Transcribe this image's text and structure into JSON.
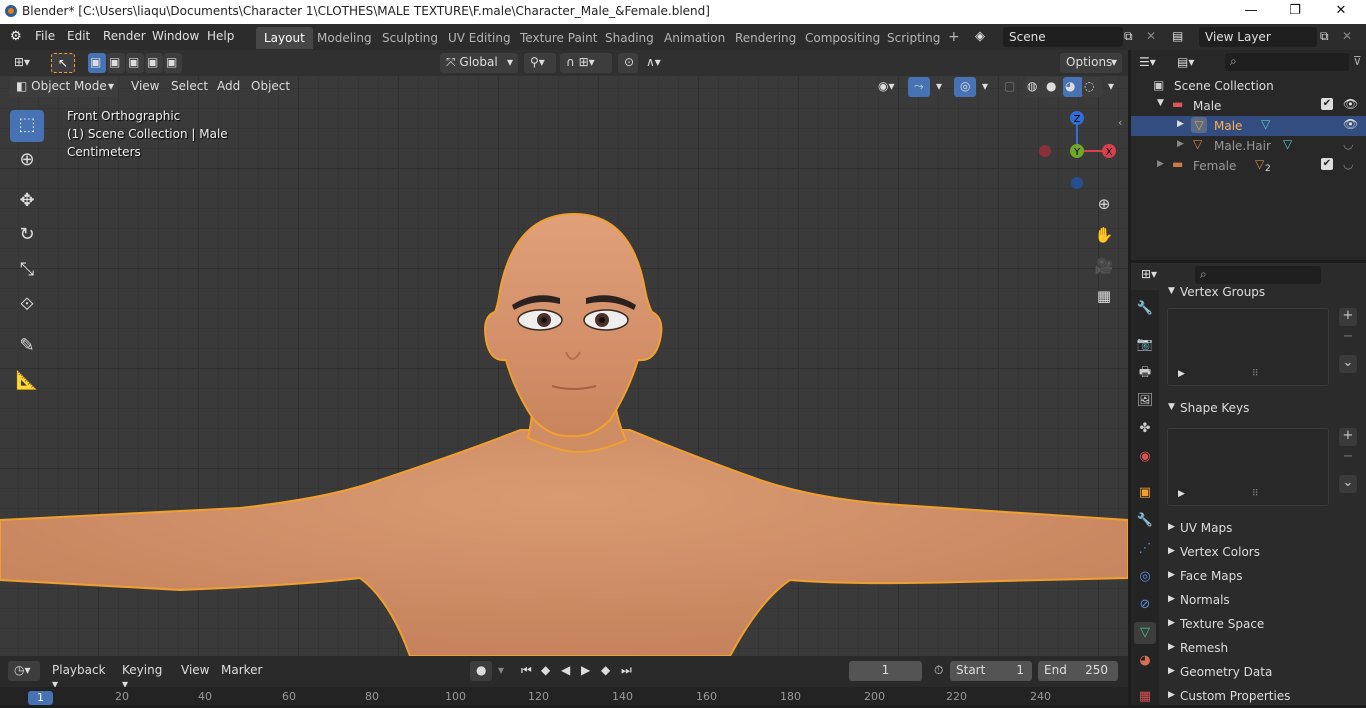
{
  "window": {
    "title": "Blender* [C:\\Users\\liaqu\\Documents\\Character 1\\CLOTHES\\MALE TEXTURE\\F.male\\Character_Male_&Female.blend]",
    "minimize": "—",
    "maximize": "❐",
    "close": "✕"
  },
  "menu": {
    "file": "File",
    "edit": "Edit",
    "render": "Render",
    "window": "Window",
    "help": "Help"
  },
  "workspaces": [
    "Layout",
    "Modeling",
    "Sculpting",
    "UV Editing",
    "Texture Paint",
    "Shading",
    "Animation",
    "Rendering",
    "Compositing",
    "Scripting"
  ],
  "scene_field": "Scene",
  "view_layer_field": "View Layer",
  "header": {
    "transform_orientation": "Global",
    "options": "Options",
    "mode": "Object Mode",
    "view": "View",
    "select": "Select",
    "add": "Add",
    "object": "Object"
  },
  "viewport": {
    "view_name": "Front Orthographic",
    "collection_info": "(1) Scene Collection | Male",
    "units": "Centimeters",
    "gizmo": {
      "z": "Z",
      "y": "Y",
      "x": "X"
    }
  },
  "outliner": {
    "search_placeholder": "",
    "root": "Scene Collection",
    "items": [
      {
        "label": "Male"
      },
      {
        "label": "Male"
      },
      {
        "label": "Male.Hair"
      },
      {
        "label": "Female"
      }
    ],
    "female_badge": "2"
  },
  "properties": {
    "search_placeholder": "",
    "panels": {
      "vertex_groups": "Vertex Groups",
      "shape_keys": "Shape Keys",
      "uv_maps": "UV Maps",
      "vertex_colors": "Vertex Colors",
      "face_maps": "Face Maps",
      "normals": "Normals",
      "texture_space": "Texture Space",
      "remesh": "Remesh",
      "geometry_data": "Geometry Data",
      "custom_properties": "Custom Properties"
    }
  },
  "timeline": {
    "playback": "Playback",
    "keying": "Keying",
    "view": "View",
    "marker": "Marker",
    "current_frame": "1",
    "start_label": "Start",
    "start_value": "1",
    "end_label": "End",
    "end_value": "250",
    "ruler": [
      "1",
      "20",
      "40",
      "60",
      "80",
      "100",
      "120",
      "140",
      "160",
      "180",
      "200",
      "220",
      "240"
    ]
  },
  "colors": {
    "accent": "#4772b3",
    "selection_outline": "#f0a030",
    "skin": "#d9956b"
  }
}
